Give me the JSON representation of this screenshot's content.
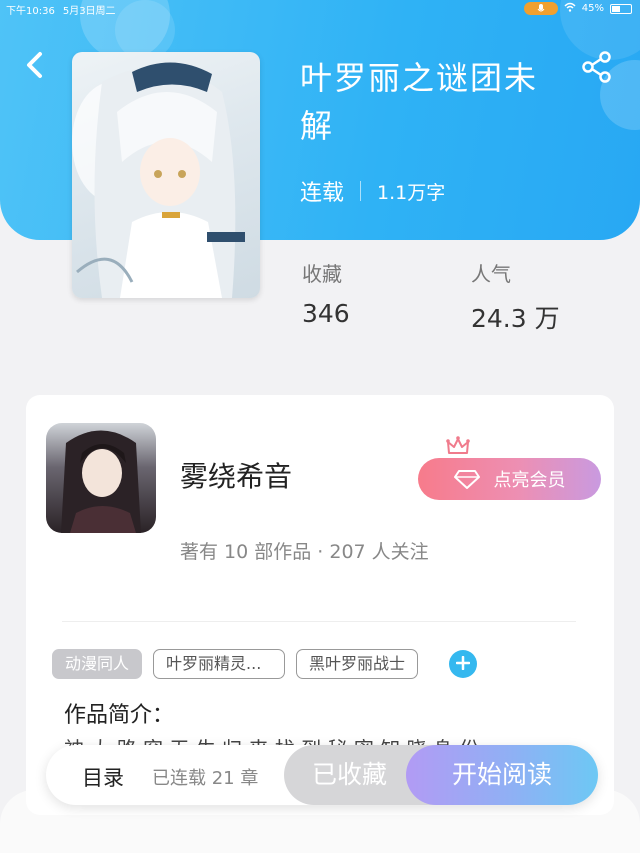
{
  "status_bar": {
    "time": "下午10:36",
    "date": "5月3日周二",
    "battery_text": "45%",
    "battery_level": 0.45
  },
  "book": {
    "title": "叶罗丽之谜团未解",
    "status": "连载",
    "word_count": "1.1万字",
    "favorites_label": "收藏",
    "favorites_value": "346",
    "popularity_label": "人气",
    "popularity_value": "24.3 万"
  },
  "author": {
    "name": "雾绕希音",
    "meta": "著有 10 部作品 · 207 人关注",
    "vip_button_label": "点亮会员"
  },
  "tags": [
    "动漫同人",
    "叶罗丽精灵...",
    "黑叶罗丽战士"
  ],
  "intro": {
    "title": "作品简介：",
    "text": "神 大 路 突    无 生 归 来    找 到 秘 密    知 晓 身 份"
  },
  "bottom_bar": {
    "toc_label": "目录",
    "toc_count": "已连载 21 章",
    "collected_label": "已收藏",
    "read_label": "开始阅读"
  },
  "colors": {
    "header_gradient_start": "#4fc3f7",
    "header_gradient_end": "#28a8f3",
    "vip_gradient_start": "#f77b8b",
    "vip_gradient_end": "#c99ae0",
    "read_gradient_start": "#b29bf4",
    "read_gradient_end": "#6dc8f4",
    "accent_blue": "#35b8ef"
  },
  "icons": [
    "back-arrow-icon",
    "share-icon",
    "crown-icon",
    "diamond-icon",
    "plus-icon",
    "wifi-icon",
    "mic-icon",
    "battery-icon"
  ]
}
